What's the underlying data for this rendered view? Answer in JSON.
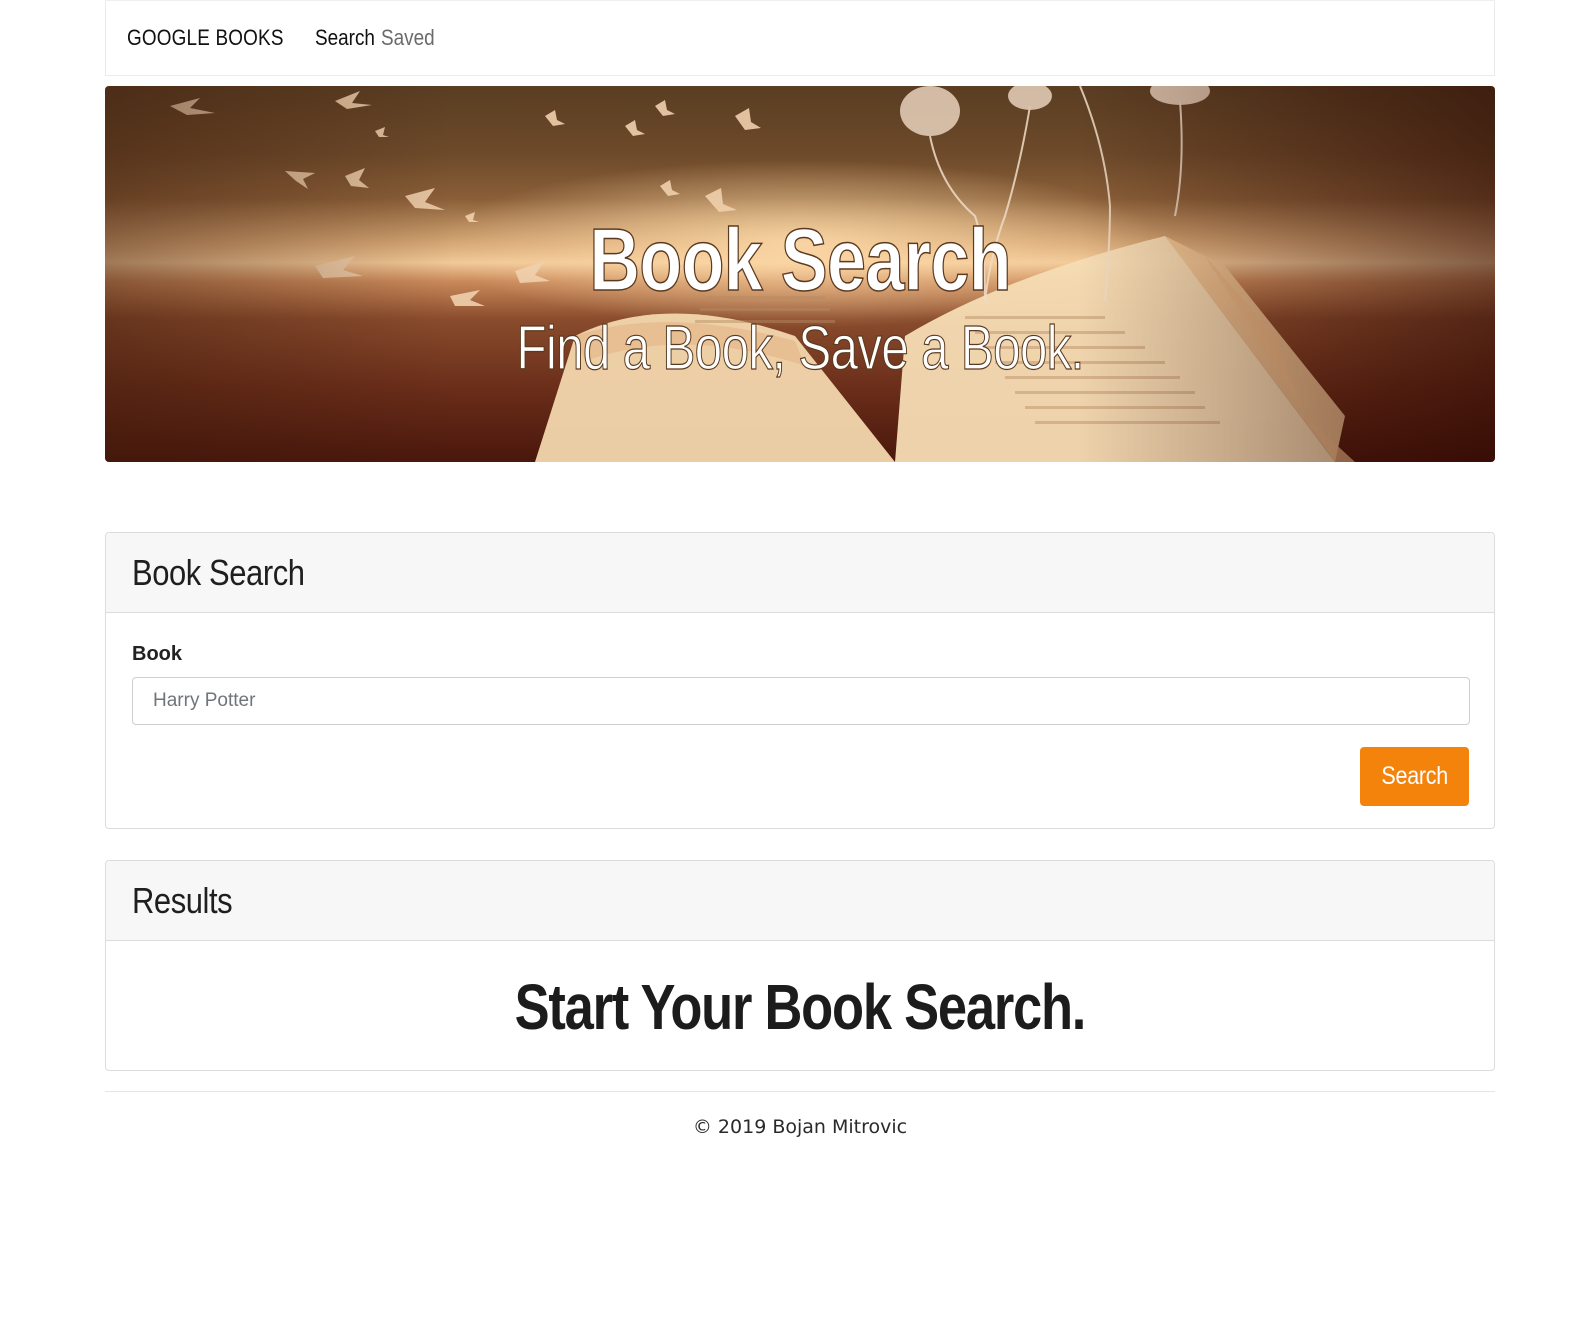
{
  "navbar": {
    "brand": "GOOGLE BOOKS",
    "links": [
      {
        "label": "Search",
        "active": true
      },
      {
        "label": "Saved",
        "active": false
      }
    ]
  },
  "hero": {
    "title": "Book Search",
    "subtitle": "Find a Book, Save a Book."
  },
  "search_card": {
    "title": "Book Search",
    "field_label": "Book",
    "input_value": "",
    "input_placeholder": "Harry Potter",
    "button_label": "Search",
    "button_color": "#f4830c"
  },
  "results_card": {
    "title": "Results",
    "empty_message": "Start Your Book Search."
  },
  "footer": {
    "copyright": "© 2019 Bojan Mitrovic"
  }
}
